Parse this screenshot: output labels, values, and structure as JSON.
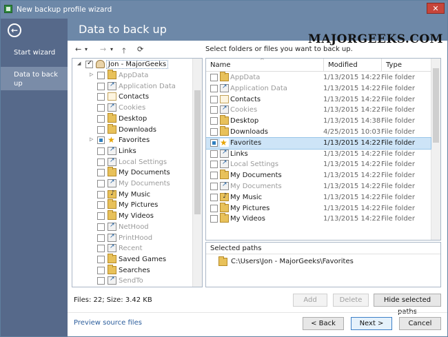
{
  "window": {
    "title": "New backup profile wizard",
    "close_glyph": "✕"
  },
  "brand": "MAJORGEEKS.COM",
  "nav": {
    "back_glyph": "←",
    "items": [
      {
        "label": "Start wizard",
        "active": false
      },
      {
        "label": "Data to back up",
        "active": true
      }
    ]
  },
  "page_title": "Data to back up",
  "toolbar": {
    "back_glyph": "←",
    "back_drop": "▾",
    "forward_glyph": "→",
    "forward_drop": "▾",
    "up_glyph": "🡑",
    "refresh_glyph": "⟳"
  },
  "instructions": "Select folders or files you want to back up.",
  "tree": {
    "root": {
      "label": "Jon - MajorGeeks",
      "checked": true
    },
    "items": [
      {
        "label": "AppData",
        "dim": true,
        "expander": true,
        "icon": "folder"
      },
      {
        "label": "Application Data",
        "dim": true,
        "expander": false,
        "icon": "link"
      },
      {
        "label": "Contacts",
        "dim": false,
        "expander": false,
        "icon": "contact"
      },
      {
        "label": "Cookies",
        "dim": true,
        "expander": false,
        "icon": "link"
      },
      {
        "label": "Desktop",
        "dim": false,
        "expander": false,
        "icon": "folder"
      },
      {
        "label": "Downloads",
        "dim": false,
        "expander": false,
        "icon": "folder"
      },
      {
        "label": "Favorites",
        "dim": false,
        "expander": true,
        "icon": "star",
        "partial": true
      },
      {
        "label": "Links",
        "dim": false,
        "expander": false,
        "icon": "link"
      },
      {
        "label": "Local Settings",
        "dim": true,
        "expander": false,
        "icon": "link"
      },
      {
        "label": "My Documents",
        "dim": false,
        "expander": false,
        "icon": "folder"
      },
      {
        "label": "My Documents",
        "dim": true,
        "expander": false,
        "icon": "link"
      },
      {
        "label": "My Music",
        "dim": false,
        "expander": false,
        "icon": "music"
      },
      {
        "label": "My Pictures",
        "dim": false,
        "expander": false,
        "icon": "folder"
      },
      {
        "label": "My Videos",
        "dim": false,
        "expander": false,
        "icon": "folder"
      },
      {
        "label": "NetHood",
        "dim": true,
        "expander": false,
        "icon": "link"
      },
      {
        "label": "PrintHood",
        "dim": true,
        "expander": false,
        "icon": "link"
      },
      {
        "label": "Recent",
        "dim": true,
        "expander": false,
        "icon": "link"
      },
      {
        "label": "Saved Games",
        "dim": false,
        "expander": false,
        "icon": "folder"
      },
      {
        "label": "Searches",
        "dim": false,
        "expander": false,
        "icon": "folder"
      },
      {
        "label": "SendTo",
        "dim": true,
        "expander": false,
        "icon": "link"
      }
    ]
  },
  "list": {
    "columns": {
      "name": "Name",
      "modified": "Modified",
      "type": "Type"
    },
    "sort_glyph": "^",
    "rows": [
      {
        "name": "AppData",
        "modified": "1/13/2015 14:22",
        "type": "File folder",
        "dim": true,
        "icon": "folder"
      },
      {
        "name": "Application Data",
        "modified": "1/13/2015 14:22",
        "type": "File folder",
        "dim": true,
        "icon": "link"
      },
      {
        "name": "Contacts",
        "modified": "1/13/2015 14:22",
        "type": "File folder",
        "dim": false,
        "icon": "contact"
      },
      {
        "name": "Cookies",
        "modified": "1/13/2015 14:22",
        "type": "File folder",
        "dim": true,
        "icon": "link"
      },
      {
        "name": "Desktop",
        "modified": "1/13/2015 14:38",
        "type": "File folder",
        "dim": false,
        "icon": "folder"
      },
      {
        "name": "Downloads",
        "modified": "4/25/2015 10:03",
        "type": "File folder",
        "dim": false,
        "icon": "folder"
      },
      {
        "name": "Favorites",
        "modified": "1/13/2015 14:22",
        "type": "File folder",
        "dim": false,
        "icon": "star",
        "selected": true
      },
      {
        "name": "Links",
        "modified": "1/13/2015 14:22",
        "type": "File folder",
        "dim": false,
        "icon": "link"
      },
      {
        "name": "Local Settings",
        "modified": "1/13/2015 14:22",
        "type": "File folder",
        "dim": true,
        "icon": "link"
      },
      {
        "name": "My Documents",
        "modified": "1/13/2015 14:22",
        "type": "File folder",
        "dim": false,
        "icon": "folder"
      },
      {
        "name": "My Documents",
        "modified": "1/13/2015 14:22",
        "type": "File folder",
        "dim": true,
        "icon": "link"
      },
      {
        "name": "My Music",
        "modified": "1/13/2015 14:22",
        "type": "File folder",
        "dim": false,
        "icon": "music"
      },
      {
        "name": "My Pictures",
        "modified": "1/13/2015 14:22",
        "type": "File folder",
        "dim": false,
        "icon": "folder"
      },
      {
        "name": "My Videos",
        "modified": "1/13/2015 14:22",
        "type": "File folder",
        "dim": false,
        "icon": "folder"
      }
    ]
  },
  "selected_paths": {
    "header": "Selected paths",
    "items": [
      "C:\\Users\\Jon - MajorGeeks\\Favorites"
    ]
  },
  "stats": "Files: 22; Size: 3.42 KB",
  "buttons": {
    "add": "Add",
    "delete": "Delete",
    "hide_selected": "Hide selected paths",
    "back": "< Back",
    "next": "Next >",
    "cancel": "Cancel"
  },
  "preview_link": "Preview source files",
  "colors": {
    "nav_bg": "#56698a",
    "header_bg": "#6d88a8",
    "selection": "#cde4f7",
    "link": "#2a5c9b"
  }
}
